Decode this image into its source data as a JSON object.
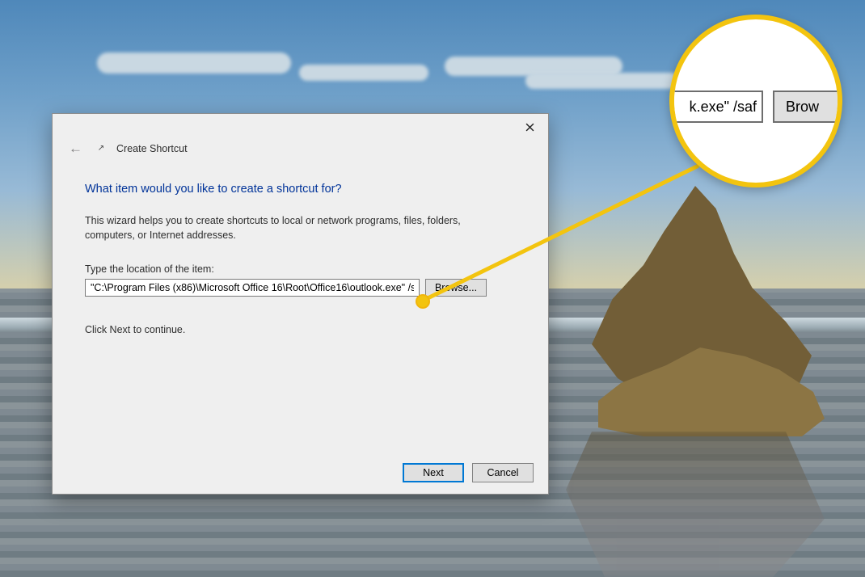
{
  "dialog": {
    "title": "Create Shortcut",
    "heading": "What item would you like to create a shortcut for?",
    "description": "This wizard helps you to create shortcuts to local or network programs, files, folders, computers, or Internet addresses.",
    "location_label": "Type the location of the item:",
    "location_value": "\"C:\\Program Files (x86)\\Microsoft Office 16\\Root\\Office16\\outlook.exe\" /saf",
    "browse_label": "Browse...",
    "continue_text": "Click Next to continue.",
    "next_label": "Next",
    "cancel_label": "Cancel"
  },
  "magnifier": {
    "input_fragment": "k.exe\" /saf",
    "button_fragment": "Brow"
  }
}
